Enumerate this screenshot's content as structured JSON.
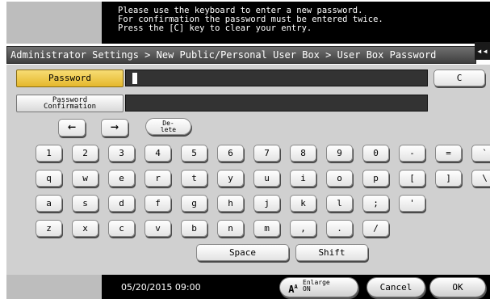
{
  "message_lines": [
    "Please use the keyboard to enter a new password.",
    "For confirmation the password must be entered twice.",
    "Press the [C] key to clear your entry."
  ],
  "breadcrumb": "Administrator Settings > New Public/Personal User Box > User Box Password",
  "back_tab": "◂◂",
  "fields": {
    "password_label": "Password",
    "confirm_label_line1": "Password",
    "confirm_label_line2": "Confirmation",
    "clear_key": "C"
  },
  "nav_keys": {
    "left": "←",
    "right": "→",
    "delete_line1": "De-",
    "delete_line2": "lete"
  },
  "keyboard_rows": [
    [
      "1",
      "2",
      "3",
      "4",
      "5",
      "6",
      "7",
      "8",
      "9",
      "0",
      "-",
      "=",
      "`"
    ],
    [
      "q",
      "w",
      "e",
      "r",
      "t",
      "y",
      "u",
      "i",
      "o",
      "p",
      "[",
      "]",
      "\\"
    ],
    [
      "a",
      "s",
      "d",
      "f",
      "g",
      "h",
      "j",
      "k",
      "l",
      ";",
      "'"
    ],
    [
      "z",
      "x",
      "c",
      "v",
      "b",
      "n",
      "m",
      ",",
      ".",
      "/"
    ]
  ],
  "space_key": "Space",
  "shift_key": "Shift",
  "footer": {
    "datetime": "05/20/2015  09:00",
    "enlarge_line1": "Enlarge",
    "enlarge_line2": "ON",
    "cancel": "Cancel",
    "ok": "OK"
  }
}
